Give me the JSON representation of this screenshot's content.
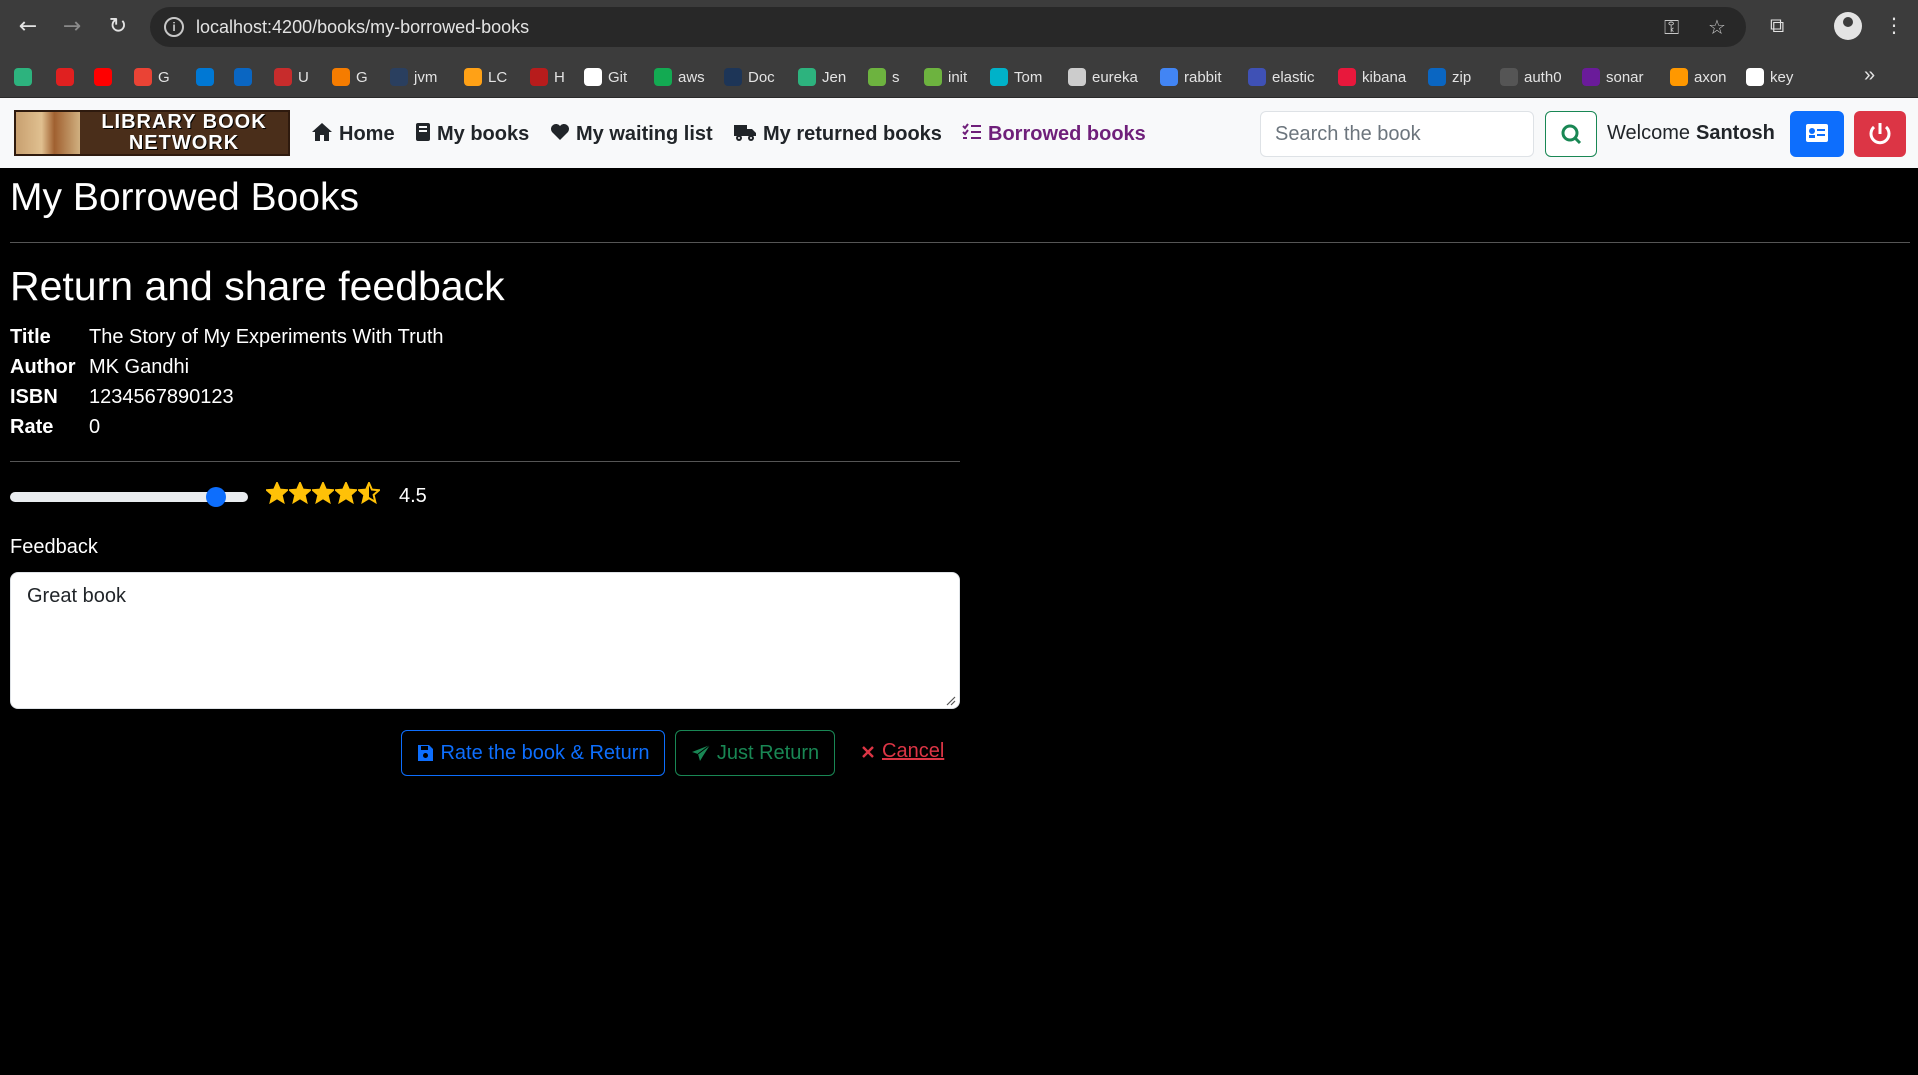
{
  "browser": {
    "url": "localhost:4200/books/my-borrowed-books",
    "bookmarks": [
      {
        "label": "",
        "color": "#2db37e"
      },
      {
        "label": "",
        "color": "#e02020"
      },
      {
        "label": "",
        "color": "#ff0000"
      },
      {
        "label": "G",
        "color": "#ea4335"
      },
      {
        "label": "",
        "color": "#0078d4"
      },
      {
        "label": "",
        "color": "#0a66c2"
      },
      {
        "label": "U",
        "color": "#c72c2c"
      },
      {
        "label": "G",
        "color": "#f57c00"
      },
      {
        "label": "jvm",
        "color": "#2a3f5f"
      },
      {
        "label": "LC",
        "color": "#ffa116"
      },
      {
        "label": "H",
        "color": "#b71c1c"
      },
      {
        "label": "Git",
        "color": "#ffffff"
      },
      {
        "label": "aws",
        "color": "#13aa52"
      },
      {
        "label": "Doc",
        "color": "#1d3557"
      },
      {
        "label": "Jen",
        "color": "#2db37e"
      },
      {
        "label": "s",
        "color": "#6db33f"
      },
      {
        "label": "init",
        "color": "#6db33f"
      },
      {
        "label": "Tom",
        "color": "#00b2c9"
      },
      {
        "label": "eureka",
        "color": "#cccccc"
      },
      {
        "label": "rabbit",
        "color": "#4285f4"
      },
      {
        "label": "elastic",
        "color": "#3f51b5"
      },
      {
        "label": "kibana",
        "color": "#e8183c"
      },
      {
        "label": "zip",
        "color": "#0a66c2"
      },
      {
        "label": "auth0",
        "color": "#555555"
      },
      {
        "label": "sonar",
        "color": "#6a1b9a"
      },
      {
        "label": "axon",
        "color": "#ff9800"
      },
      {
        "label": "key",
        "color": "#ffffff"
      }
    ]
  },
  "app": {
    "logo_text": "LIBRARY BOOK NETWORK",
    "nav": [
      {
        "label": "Home",
        "icon": "home-icon"
      },
      {
        "label": "My books",
        "icon": "book-icon"
      },
      {
        "label": "My waiting list",
        "icon": "heart-icon"
      },
      {
        "label": "My returned books",
        "icon": "truck-icon"
      },
      {
        "label": "Borrowed books",
        "icon": "list-check-icon"
      }
    ],
    "search_placeholder": "Search the book",
    "welcome_label": "Welcome",
    "user_name": "Santosh"
  },
  "page": {
    "title": "My Borrowed Books",
    "section_title": "Return and share feedback",
    "details": [
      {
        "label": "Title",
        "value": "The Story of My Experiments With Truth"
      },
      {
        "label": "Author",
        "value": "MK Gandhi"
      },
      {
        "label": "ISBN",
        "value": "1234567890123"
      },
      {
        "label": "Rate",
        "value": "0"
      }
    ],
    "rating": {
      "value": "4.5",
      "max": 5
    },
    "feedback_label": "Feedback",
    "feedback_text": "Great book",
    "buttons": {
      "rate_return": "Rate the book & Return",
      "just_return": "Just Return",
      "cancel": "Cancel"
    }
  },
  "colors": {
    "primary": "#0d6efd",
    "success": "#198754",
    "danger": "#dc3545",
    "active_nav": "#6f1f7a",
    "star": "#ffc107"
  }
}
